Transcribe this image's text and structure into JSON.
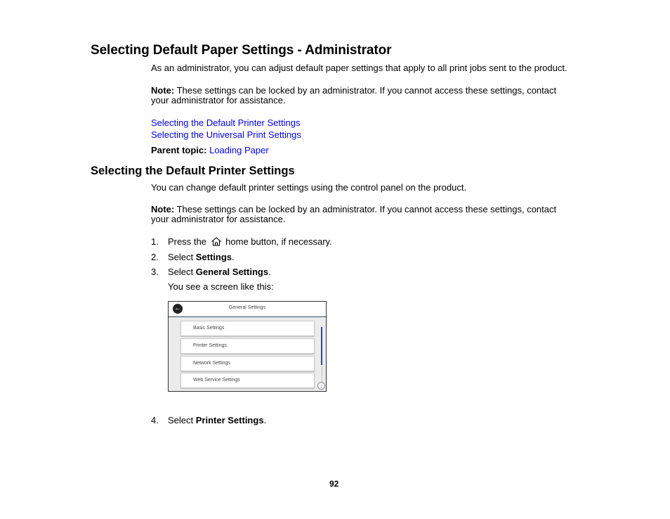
{
  "heading": "Selecting Default Paper Settings - Administrator",
  "intro": "As an administrator, you can adjust default paper settings that apply to all print jobs sent to the product.",
  "note1": {
    "label": "Note:",
    "text": " These settings can be locked by an administrator. If you cannot access these settings, contact",
    "text2": "your administrator for assistance."
  },
  "links": [
    "Selecting the Default Printer Settings",
    "Selecting the Universal Print Settings"
  ],
  "parent_topic": {
    "label": "Parent topic:",
    "link": "Loading Paper"
  },
  "subheading": "Selecting the Default Printer Settings",
  "sub_intro": "You can change default printer settings using the control panel on the product.",
  "note2": {
    "label": "Note:",
    "text": " These settings can be locked by an administrator. If you cannot access these settings, contact",
    "text2": "your administrator for assistance."
  },
  "steps": [
    {
      "num": "1.",
      "pre": "Press the",
      "icon": "home-icon",
      "post": " home button, if necessary."
    },
    {
      "num": "2.",
      "pre": "Select ",
      "bold": "Settings",
      "post": "."
    },
    {
      "num": "3.",
      "pre": "Select ",
      "bold": "General Settings",
      "post": "."
    },
    {
      "num": "4.",
      "pre": "Select ",
      "bold": "Printer Settings",
      "post": "."
    }
  ],
  "step3_followup": "You see a screen like this:",
  "screen": {
    "title": "General Settings",
    "back_icon": "back-arrow-icon",
    "items": [
      "Basic Settings",
      "Printer Settings",
      "Network Settings",
      "Web Service Settings"
    ],
    "scroll_icon": "scroll-down-icon"
  },
  "page_number": "92"
}
